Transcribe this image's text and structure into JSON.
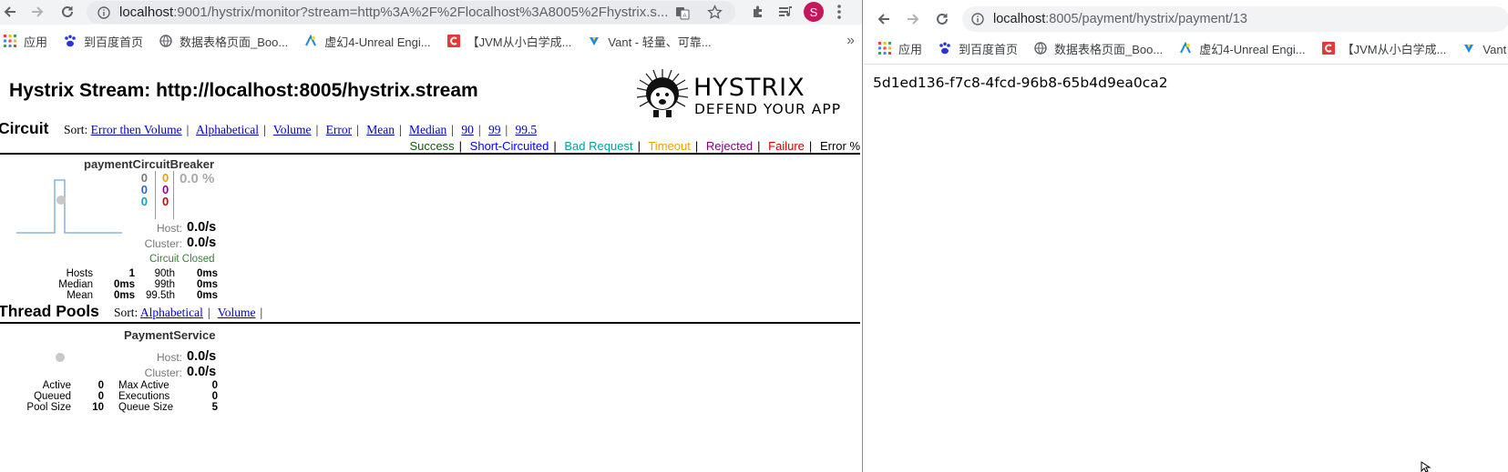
{
  "left": {
    "url_host": "localhost",
    "url_rest": ":9001/hystrix/monitor?stream=http%3A%2F%2Flocalhost%3A8005%2Fhystrix.s...",
    "profile_initial": "S",
    "bookmarks": [
      "应用",
      "到百度首页",
      "数据表格页面_Boo...",
      "虚幻4-Unreal Engi...",
      "【JVM从小白学成...",
      "Vant - 轻量、可靠..."
    ],
    "bookmarks_more": "»",
    "title": "Hystrix Stream: http://localhost:8005/hystrix.stream",
    "logo_line1": "HYSTRIX",
    "logo_line2": "DEFEND YOUR APP",
    "circuit": {
      "heading": "Circuit",
      "sort_label": "Sort:",
      "sort_links": [
        "Error then Volume",
        "Alphabetical",
        "Volume",
        "Error",
        "Mean",
        "Median",
        "90",
        "99",
        "99.5"
      ],
      "legend": [
        {
          "label": "Success",
          "color": "#0b5f0b"
        },
        {
          "label": "Short-Circuited",
          "color": "#0000ff"
        },
        {
          "label": "Bad Request",
          "color": "#00a0a0"
        },
        {
          "label": "Timeout",
          "color": "#f0a000"
        },
        {
          "label": "Rejected",
          "color": "#800080"
        },
        {
          "label": "Failure",
          "color": "#d00000"
        },
        {
          "label": "Error %",
          "color": "#000000"
        }
      ],
      "card": {
        "name": "paymentCircuitBreaker",
        "counts_col1": [
          "0",
          "0",
          "0"
        ],
        "counts_col2": [
          "0",
          "0",
          "0"
        ],
        "error_pct": "0.0 %",
        "host_label": "Host:",
        "host_rate": "0.0/s",
        "cluster_label": "Cluster:",
        "cluster_rate": "0.0/s",
        "status": "Circuit Closed",
        "stats": {
          "hosts_label": "Hosts",
          "hosts": "1",
          "p90_label": "90th",
          "p90": "0ms",
          "median_label": "Median",
          "median": "0ms",
          "p99_label": "99th",
          "p99": "0ms",
          "mean_label": "Mean",
          "mean": "0ms",
          "p995_label": "99.5th",
          "p995": "0ms"
        }
      }
    },
    "threads": {
      "heading": "Thread Pools",
      "sort_label": "Sort:",
      "sort_links": [
        "Alphabetical",
        "Volume"
      ],
      "card": {
        "name": "PaymentService",
        "host_label": "Host:",
        "host_rate": "0.0/s",
        "cluster_label": "Cluster:",
        "cluster_rate": "0.0/s",
        "stats": {
          "active_label": "Active",
          "active": "0",
          "max_active_label": "Max Active",
          "max_active": "0",
          "queued_label": "Queued",
          "queued": "0",
          "executions_label": "Executions",
          "executions": "0",
          "pool_size_label": "Pool Size",
          "pool_size": "10",
          "queue_size_label": "Queue Size",
          "queue_size": "5"
        }
      }
    }
  },
  "right": {
    "url_host": "localhost",
    "url_rest": ":8005/payment/hystrix/payment/13",
    "bookmarks": [
      "应用",
      "到百度首页",
      "数据表格页面_Boo...",
      "虚幻4-Unreal Engi...",
      "【JVM从小白学成...",
      "Vant - 轻量、可靠..."
    ],
    "body_text": "5d1ed136-f7c8-4fcd-96b8-65b4d9ea0ca2"
  }
}
